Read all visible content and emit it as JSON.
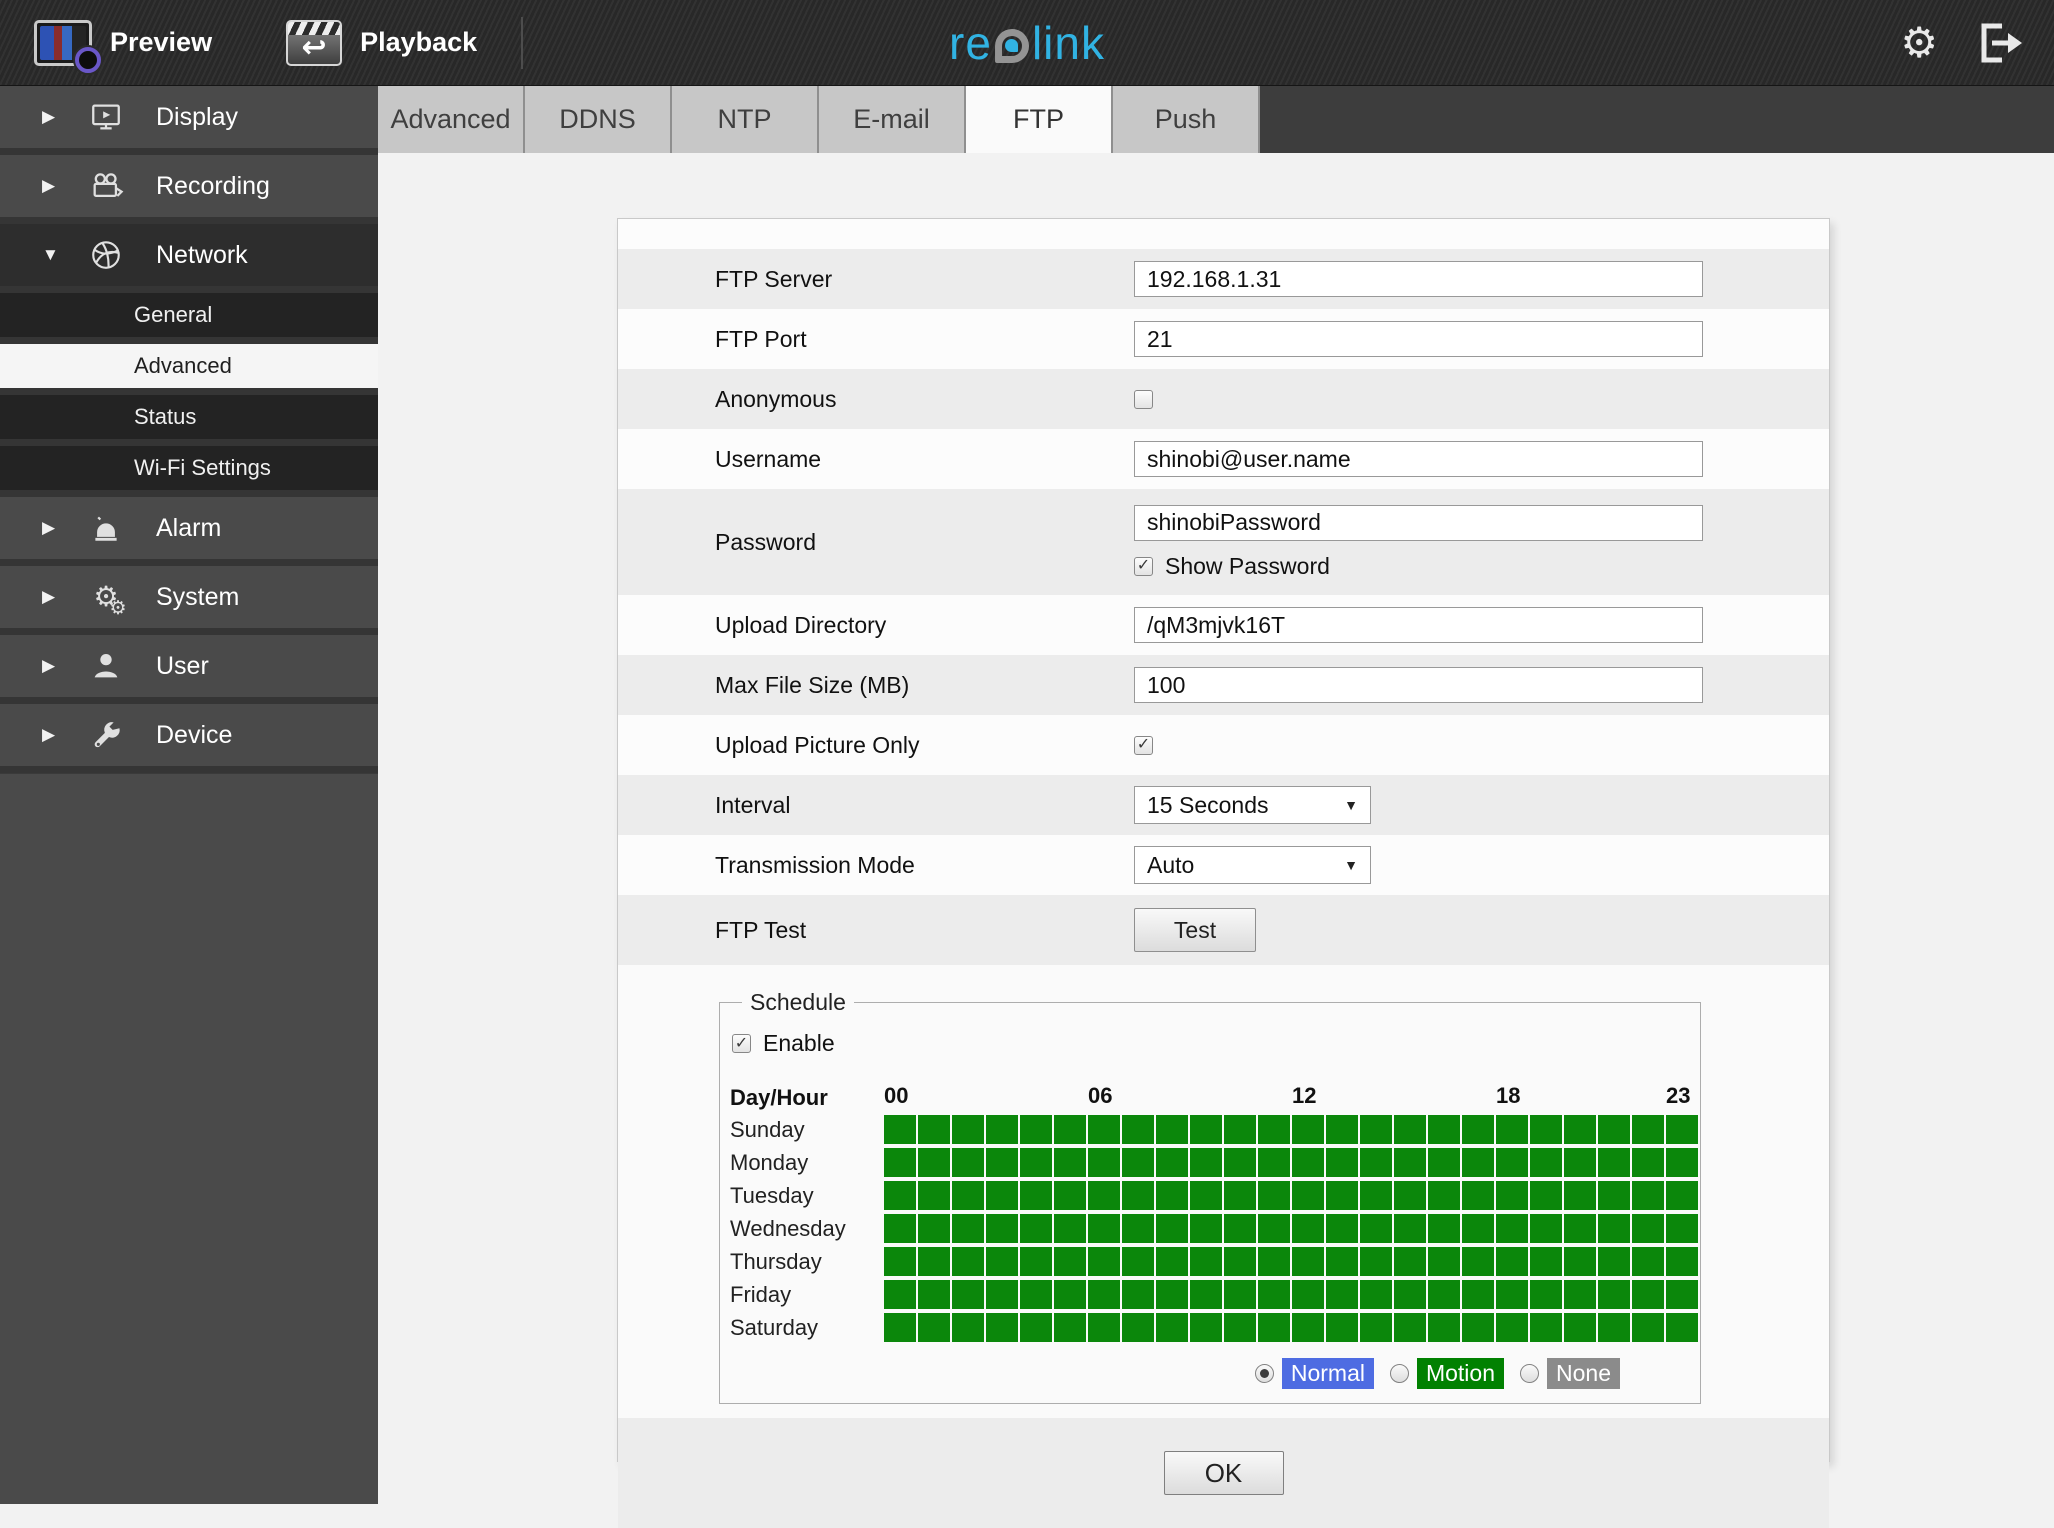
{
  "topbar": {
    "preview_label": "Preview",
    "playback_label": "Playback",
    "brand": {
      "part1": "re",
      "part2": "link"
    }
  },
  "sidebar": {
    "items": [
      {
        "label": "Display"
      },
      {
        "label": "Recording"
      },
      {
        "label": "Network"
      },
      {
        "label": "Alarm"
      },
      {
        "label": "System"
      },
      {
        "label": "User"
      },
      {
        "label": "Device"
      }
    ],
    "network_children": [
      {
        "label": "General",
        "selected": false
      },
      {
        "label": "Advanced",
        "selected": true
      },
      {
        "label": "Status",
        "selected": false
      },
      {
        "label": "Wi-Fi Settings",
        "selected": false
      }
    ]
  },
  "tabs": {
    "items": [
      "Advanced",
      "DDNS",
      "NTP",
      "E-mail",
      "FTP",
      "Push"
    ],
    "active": "FTP"
  },
  "form": {
    "ftp_server": {
      "label": "FTP Server",
      "value": "192.168.1.31"
    },
    "ftp_port": {
      "label": "FTP Port",
      "value": "21"
    },
    "anonymous": {
      "label": "Anonymous",
      "checked": false
    },
    "username": {
      "label": "Username",
      "value": "shinobi@user.name"
    },
    "password": {
      "label": "Password",
      "value": "shinobiPassword",
      "show_password_label": "Show Password",
      "show_password_checked": true
    },
    "upload_directory": {
      "label": "Upload Directory",
      "value": "/qM3mjvk16T"
    },
    "max_file_size": {
      "label": "Max File Size (MB)",
      "value": "100"
    },
    "upload_picture_only": {
      "label": "Upload Picture Only",
      "checked": true
    },
    "interval": {
      "label": "Interval",
      "value": "15 Seconds"
    },
    "transmission_mode": {
      "label": "Transmission Mode",
      "value": "Auto"
    },
    "ftp_test": {
      "label": "FTP Test",
      "button_label": "Test"
    }
  },
  "schedule": {
    "legend": "Schedule",
    "enable_label": "Enable",
    "enable_checked": true,
    "header_label": "Day/Hour",
    "hour_marks": [
      {
        "label": "00",
        "col": 0
      },
      {
        "label": "06",
        "col": 6
      },
      {
        "label": "12",
        "col": 12
      },
      {
        "label": "18",
        "col": 18
      },
      {
        "label": "23",
        "col": 23
      }
    ],
    "days": [
      "Sunday",
      "Monday",
      "Tuesday",
      "Wednesday",
      "Thursday",
      "Friday",
      "Saturday"
    ],
    "columns": 24,
    "all_cells_state": "selected",
    "modes": [
      {
        "label": "Normal",
        "color": "#4e6ce2",
        "selected": true
      },
      {
        "label": "Motion",
        "color": "#018101",
        "selected": false
      },
      {
        "label": "None",
        "color": "#8b8b8b",
        "selected": false
      }
    ]
  },
  "footer": {
    "ok_label": "OK"
  },
  "colors": {
    "brand_cyan": "#31b3e3",
    "pin_gray": "#949494",
    "cell_green": "#0b870b"
  }
}
